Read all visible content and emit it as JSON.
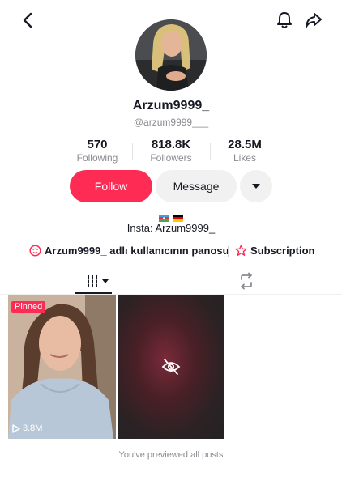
{
  "profile": {
    "display_name": "Arzum9999_",
    "username": "@arzum9999___",
    "bio": "Insta: Arzum9999_",
    "flags": [
      "flag-azerbaijan",
      "flag-germany"
    ]
  },
  "stats": {
    "following_value": "570",
    "following_label": "Following",
    "followers_value": "818.8K",
    "followers_label": "Followers",
    "likes_value": "28.5M",
    "likes_label": "Likes"
  },
  "actions": {
    "follow_label": "Follow",
    "message_label": "Message"
  },
  "links": {
    "showcase_label": "Arzum9999_ adlı kullanıcının panosu",
    "subscription_label": "Subscription"
  },
  "posts": [
    {
      "badge": "Pinned",
      "views": "3.8M"
    }
  ],
  "footer": {
    "previewed_text": "You've previewed all posts"
  },
  "colors": {
    "accent": "#fe2c55",
    "secondary_button": "#f1f1f2",
    "muted_text": "#8a8b91"
  },
  "icons": {
    "back": "chevron-left-icon",
    "notifications": "bell-icon",
    "share": "share-arrow-icon",
    "more": "caret-down-icon",
    "showcase": "shop-face-icon",
    "subscription": "star-badge-icon",
    "videos_tab": "grid-icon",
    "reposts_tab": "repost-icon",
    "play": "play-icon",
    "hidden": "eye-off-icon"
  }
}
